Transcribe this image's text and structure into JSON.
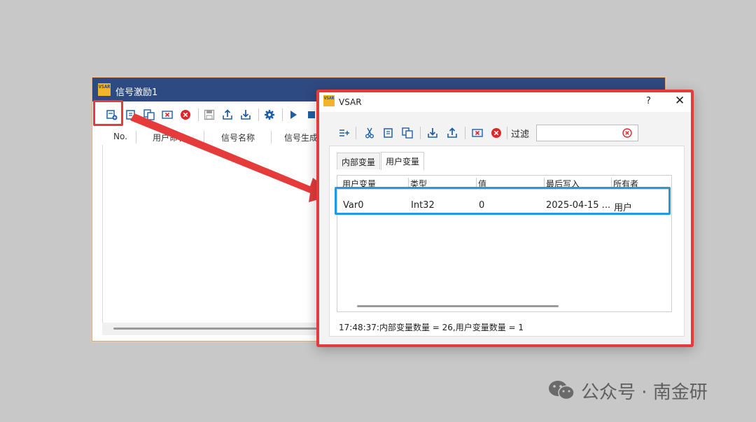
{
  "back_window": {
    "title": "信号激励1",
    "logo_text": "VSAR",
    "columns": [
      "No.",
      "用户命名",
      "信号名称",
      "信号生成"
    ]
  },
  "front_window": {
    "title": "VSAR",
    "logo_text": "VSAR",
    "help_label": "?",
    "close_label": "✕",
    "filter_label": "过滤",
    "filter_value": "",
    "tabs": [
      {
        "label": "内部变量",
        "active": false
      },
      {
        "label": "用户变量",
        "active": true
      }
    ],
    "table": {
      "columns": [
        "用户变量",
        "类型",
        "值",
        "最后写入",
        "所有者"
      ],
      "rows": [
        {
          "name": "Var0",
          "type": "Int32",
          "value": "0",
          "last_write": "2025-04-15 ...",
          "owner": "用户"
        }
      ]
    },
    "status": "17:48:37:内部变量数量 = 26,用户变量数量 = 1"
  },
  "watermark": "公众号 · 南金研",
  "colors": {
    "title_bar": "#2e4a82",
    "highlight_red": "#e53b3b",
    "highlight_blue": "#1e9be4",
    "icon_blue": "#1e5fa8",
    "icon_red": "#e0252b",
    "logo_yellow": "#f1b42a"
  },
  "icons": [
    "add-variable-icon",
    "copy-icon",
    "paste-icon",
    "delete-icon",
    "clear-icon",
    "save-icon",
    "export-icon",
    "import-icon",
    "settings-icon",
    "play-icon",
    "stop-icon",
    "cut-icon",
    "filter-clear-icon",
    "wechat-icon"
  ]
}
